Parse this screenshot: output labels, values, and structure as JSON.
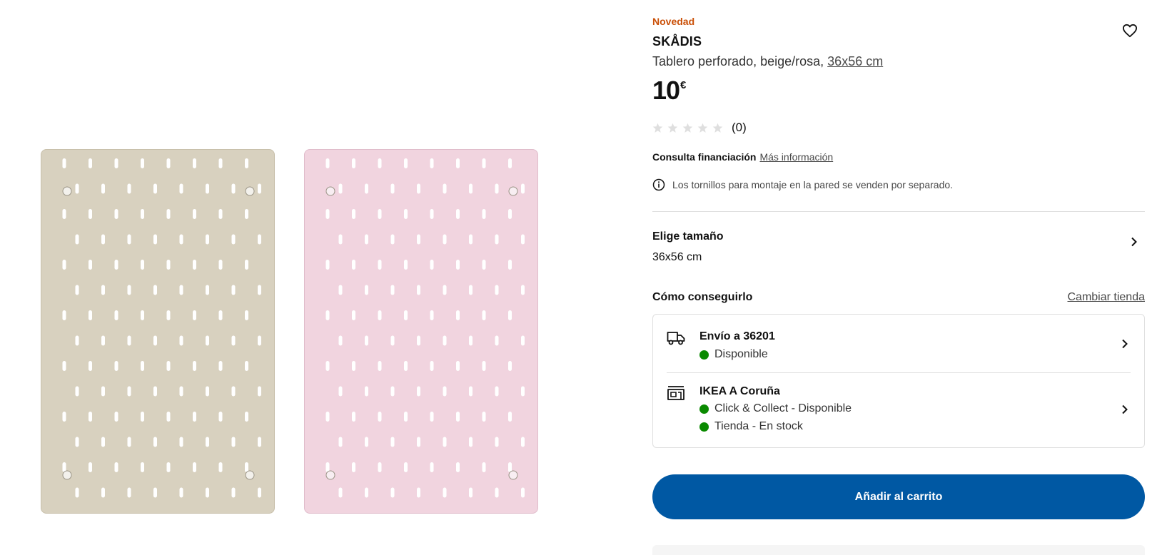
{
  "product": {
    "badge": "Novedad",
    "name": "SKÅDIS",
    "description": "Tablero perforado, beige/rosa,",
    "size_link": "36x56 cm",
    "price": "10",
    "currency": "€",
    "rating": {
      "stars": 0,
      "max_stars": 5,
      "count": "(0)"
    }
  },
  "financing": {
    "label": "Consulta financiación",
    "link": "Más información"
  },
  "notice": {
    "icon": "info-icon",
    "text": "Los tornillos para montaje en la pared se venden por separado."
  },
  "size": {
    "title": "Elige tamaño",
    "value": "36x56 cm"
  },
  "availability": {
    "title": "Cómo conseguirlo",
    "change_store": "Cambiar tienda",
    "delivery": {
      "icon": "truck-icon",
      "title": "Envío a 36201",
      "status": "Disponible"
    },
    "store": {
      "icon": "store-icon",
      "title": "IKEA A Coruña",
      "status_collect": "Click & Collect - Disponible",
      "status_store": "Tienda - En stock"
    },
    "status_color": "#0a8a00"
  },
  "cart": {
    "label": "Añadir al carrito"
  },
  "colors": {
    "accent": "#0058a3",
    "badge": "#ca5008",
    "board_beige": "#d8d1bf",
    "board_pink": "#f1d4df"
  }
}
